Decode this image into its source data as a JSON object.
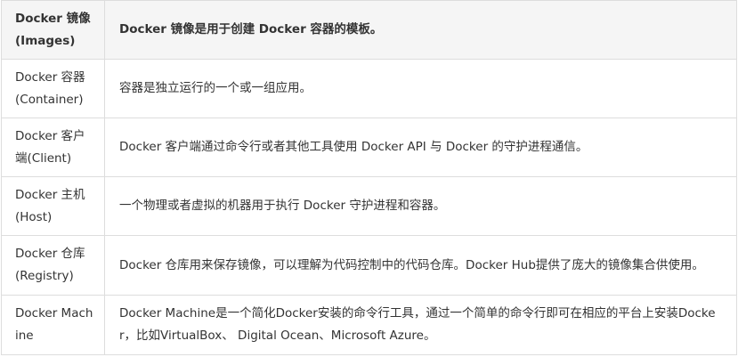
{
  "table": {
    "header": {
      "term": "Docker 镜像(Images)",
      "description": "Docker 镜像是用于创建 Docker 容器的模板。"
    },
    "rows": [
      {
        "term": "Docker 容器(Container)",
        "description": "容器是独立运行的一个或一组应用。"
      },
      {
        "term": "Docker 客户端(Client)",
        "description": "Docker 客户端通过命令行或者其他工具使用 Docker API 与 Docker 的守护进程通信。"
      },
      {
        "term": "Docker 主机(Host)",
        "description": "一个物理或者虚拟的机器用于执行 Docker 守护进程和容器。"
      },
      {
        "term": "Docker 仓库(Registry)",
        "description": "Docker 仓库用来保存镜像，可以理解为代码控制中的代码仓库。Docker Hub提供了庞大的镜像集合供使用。"
      },
      {
        "term": "Docker Machine",
        "description": "Docker Machine是一个简化Docker安装的命令行工具，通过一个简单的命令行即可在相应的平台上安装Docker，比如VirtualBox、 Digital Ocean、Microsoft Azure。"
      }
    ]
  }
}
